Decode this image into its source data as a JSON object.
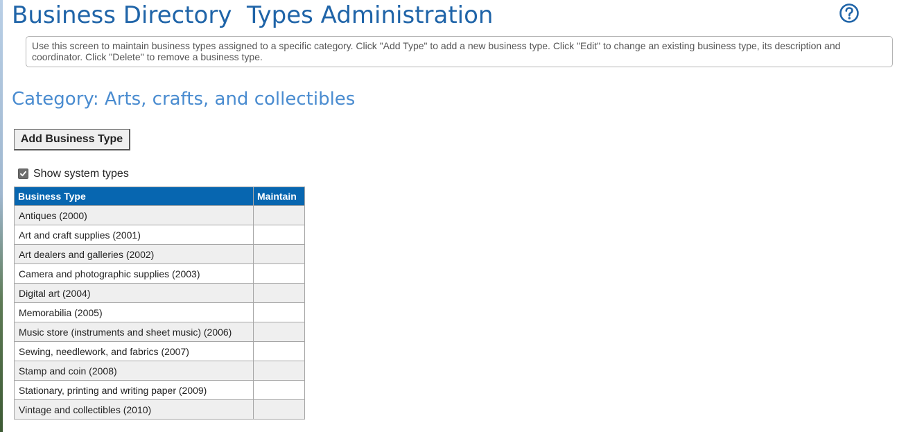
{
  "header": {
    "title": "Business Directory  Types Administration",
    "help_icon": "question-circle-icon",
    "accent_color": "#1f64a8"
  },
  "instructions": {
    "text": "Use this screen to maintain business types assigned to a specific category. Click \"Add Type\" to add a new business type. Click \"Edit\" to change an existing business type, its description and coordinator. Click \"Delete\" to remove a business type."
  },
  "category": {
    "title": "Category: Arts, crafts, and collectibles"
  },
  "toolbar": {
    "add_label": "Add Business Type"
  },
  "filter": {
    "show_system_label": "Show system types",
    "show_system_checked": true
  },
  "table": {
    "header_color": "#0766b0",
    "columns": [
      "Business Type",
      "Maintain"
    ],
    "rows": [
      {
        "type": "Antiques (2000)",
        "maintain": ""
      },
      {
        "type": "Art and craft supplies (2001)",
        "maintain": ""
      },
      {
        "type": "Art dealers and galleries (2002)",
        "maintain": ""
      },
      {
        "type": "Camera and photographic supplies (2003)",
        "maintain": ""
      },
      {
        "type": "Digital art (2004)",
        "maintain": ""
      },
      {
        "type": "Memorabilia (2005)",
        "maintain": ""
      },
      {
        "type": "Music store (instruments and sheet music) (2006)",
        "maintain": ""
      },
      {
        "type": "Sewing, needlework, and fabrics (2007)",
        "maintain": ""
      },
      {
        "type": "Stamp and coin (2008)",
        "maintain": ""
      },
      {
        "type": "Stationary, printing and writing paper (2009)",
        "maintain": ""
      },
      {
        "type": "Vintage and collectibles (2010)",
        "maintain": ""
      }
    ]
  }
}
